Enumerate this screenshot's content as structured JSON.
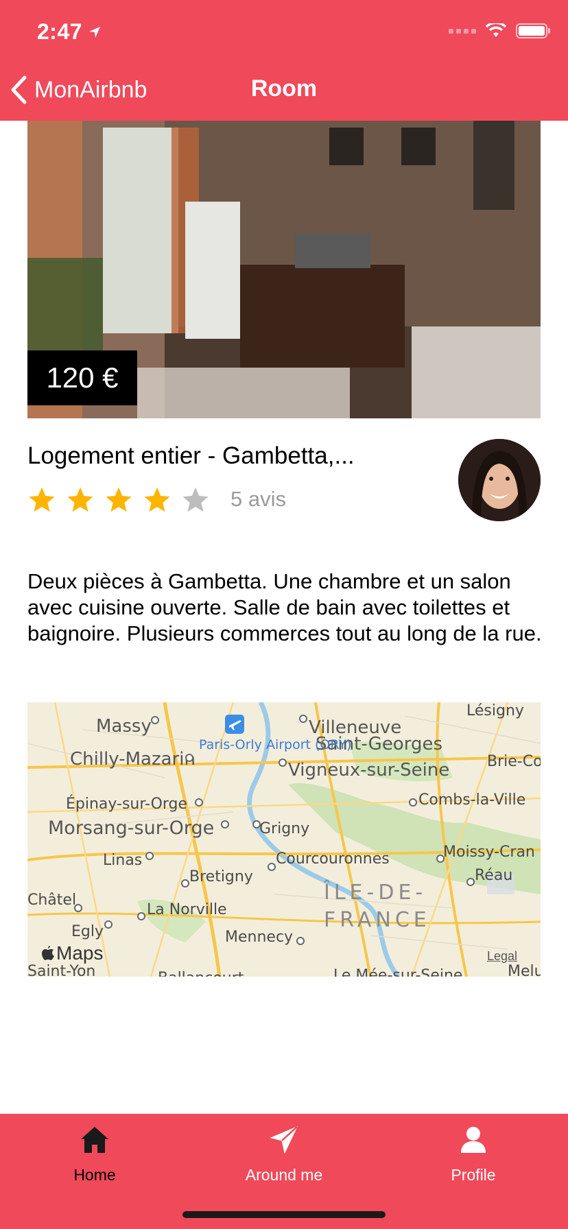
{
  "status_bar": {
    "time": "2:47"
  },
  "nav": {
    "back_label": "MonAirbnb",
    "title": "Room"
  },
  "room": {
    "price": "120 €",
    "title": "Logement entier - Gambetta,...",
    "rating": 4,
    "rating_max": 5,
    "reviews": "5 avis",
    "description": "Deux pièces à Gambetta. Une chambre et un salon avec cuisine ouverte. Salle de bain avec toilettes et baignoire. Plusieurs commerces tout au long de la rue."
  },
  "map": {
    "places": {
      "massy": "Massy",
      "villeneuve": "Villeneuve",
      "saint_georges": "Saint-Georges",
      "lesigny": "Lésigny",
      "chilly": "Chilly-Mazarin",
      "airport": "Paris-Orly Airport (ORY)",
      "vigneux": "Vigneux-sur-Seine",
      "brie": "Brie-Comt",
      "epinay": "Épinay-sur-Orge",
      "combs": "Combs-la-Ville",
      "morsang": "Morsang-sur-Orge",
      "grigny": "Grigny",
      "moissy": "Moissy-Cran",
      "linas": "Linas",
      "courcouronnes": "Courcouronnes",
      "bretigny": "Bretigny",
      "reau": "Réau",
      "chatel": "Châtel",
      "region_line1": "ÎLE-DE-",
      "region_line2": "FRANCE",
      "la_norville": "La Norville",
      "egly": "Egly",
      "mennecy": "Mennecy",
      "saint_yon": "Saint-Yon",
      "ballancourt": "Ballancourt",
      "le_mee": "Le Mée-sur-Seine",
      "melun": "Melu"
    },
    "attribution": "Maps",
    "legal": "Legal"
  },
  "tabs": [
    {
      "label": "Home",
      "icon": "home-icon",
      "active": true
    },
    {
      "label": "Around me",
      "icon": "paper-plane-icon",
      "active": false
    },
    {
      "label": "Profile",
      "icon": "person-icon",
      "active": false
    }
  ],
  "colors": {
    "brand": "#F0495A",
    "star_active": "#FFB400",
    "star_inactive": "#BDBDBD"
  }
}
